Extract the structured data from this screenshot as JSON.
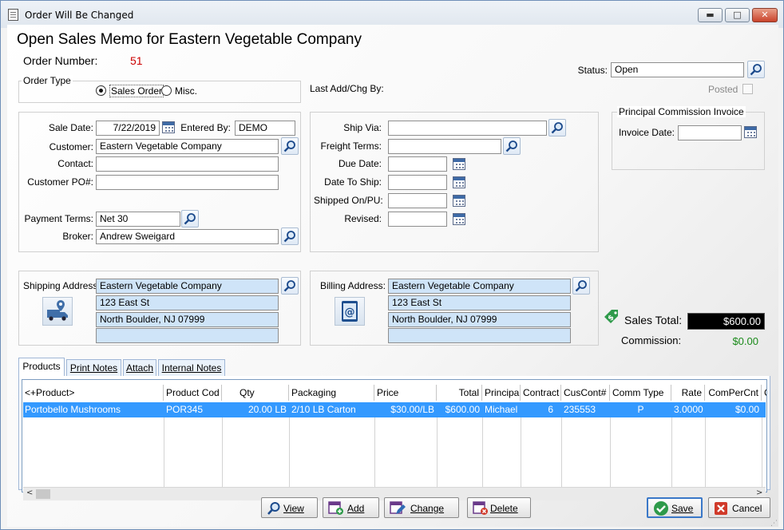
{
  "window": {
    "title": "Order Will Be Changed",
    "minimize": "▬",
    "restore": "□",
    "close": "✕"
  },
  "header": {
    "title": "Open Sales Memo for Eastern Vegetable Company",
    "order_number_label": "Order Number:",
    "order_number": "51"
  },
  "order_type": {
    "group_label": "Order Type",
    "sales_order_label": "Sales Order",
    "misc_label": "Misc.",
    "selected": "Sales Order"
  },
  "status": {
    "label": "Status:",
    "value": "Open",
    "posted_label": "Posted",
    "last_add_chg_label": "Last Add/Chg By:"
  },
  "sale": {
    "sale_date_label": "Sale Date:",
    "sale_date": "7/22/2019",
    "entered_by_label": "Entered By:",
    "entered_by": "DEMO",
    "customer_label": "Customer:",
    "customer": "Eastern Vegetable Company",
    "contact_label": "Contact:",
    "contact": "",
    "customer_po_label": "Customer PO#:",
    "customer_po": "",
    "payment_terms_label": "Payment Terms:",
    "payment_terms": "Net 30",
    "broker_label": "Broker:",
    "broker": "Andrew Sweigard"
  },
  "shipping": {
    "ship_via_label": "Ship Via:",
    "ship_via": "",
    "freight_terms_label": "Freight Terms:",
    "freight_terms": "",
    "due_date_label": "Due Date:",
    "due_date": "",
    "date_to_ship_label": "Date To Ship:",
    "date_to_ship": "",
    "shipped_on_label": "Shipped On/PU:",
    "shipped_on": "",
    "revised_label": "Revised:",
    "revised": ""
  },
  "principal_commission": {
    "group_label": "Principal Commission Invoice",
    "invoice_date_label": "Invoice Date:",
    "invoice_date": ""
  },
  "shipping_address": {
    "label": "Shipping Address:",
    "line1": "Eastern Vegetable Company",
    "line2": "123 East St",
    "line3": "North Boulder, NJ 07999",
    "line4": ""
  },
  "billing_address": {
    "label": "Billing Address:",
    "line1": "Eastern Vegetable Company",
    "line2": "123 East St",
    "line3": "North Boulder, NJ 07999",
    "line4": ""
  },
  "totals": {
    "sales_total_label": "Sales Total:",
    "sales_total": "$600.00",
    "commission_label": "Commission:",
    "commission": "$0.00"
  },
  "tabs": [
    {
      "label": "Products"
    },
    {
      "label": "Print Notes"
    },
    {
      "label": "Attach"
    },
    {
      "label": "Internal Notes"
    }
  ],
  "table": {
    "columns": [
      "<+Product>",
      "Product Cod",
      "Qty",
      "Packaging",
      "Price",
      "Total",
      "Principa",
      "Contract",
      "CusCont#",
      "Comm Type",
      "Rate",
      "ComPerCnt",
      "C"
    ],
    "rows": [
      [
        "Portobello Mushrooms",
        "POR345",
        "20.00 LB",
        "2/10  LB Carton",
        "$30.00/LB",
        "$600.00",
        "Michael",
        "6",
        "235553",
        "P",
        "3.0000",
        "$0.00",
        ""
      ]
    ]
  },
  "buttons": {
    "view": "View",
    "add": "Add",
    "change": "Change",
    "delete": "Delete",
    "save": "Save",
    "cancel": "Cancel"
  },
  "colors": {
    "selection": "#3399ff",
    "order_number": "#cc0000",
    "commission": "#1a8a1a",
    "total_box": "#000000"
  }
}
